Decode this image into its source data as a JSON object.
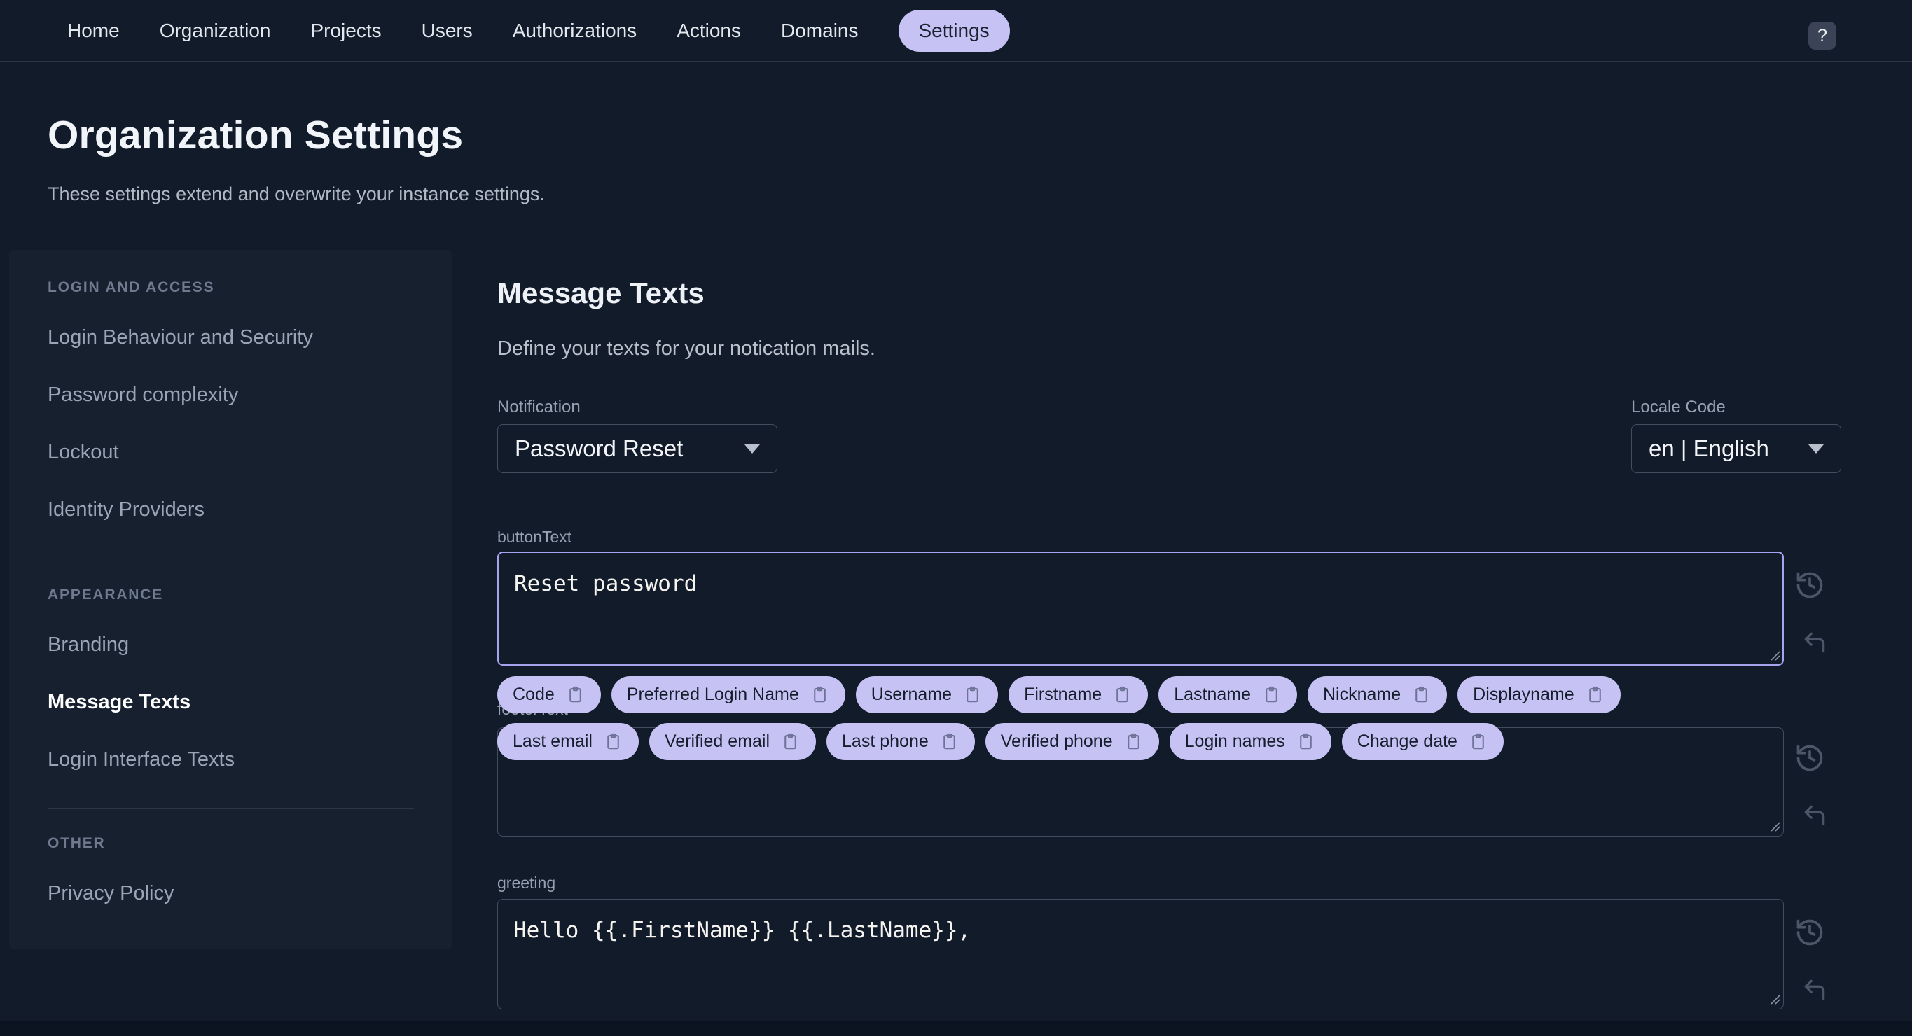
{
  "nav": {
    "items": [
      {
        "label": "Home"
      },
      {
        "label": "Organization"
      },
      {
        "label": "Projects"
      },
      {
        "label": "Users"
      },
      {
        "label": "Authorizations"
      },
      {
        "label": "Actions"
      },
      {
        "label": "Domains"
      },
      {
        "label": "Settings",
        "active": true
      }
    ],
    "help_label": "?"
  },
  "page": {
    "title": "Organization Settings",
    "subtitle": "These settings extend and overwrite your instance settings."
  },
  "sidebar": {
    "sections": [
      {
        "header": "LOGIN AND ACCESS",
        "items": [
          {
            "label": "Login Behaviour and Security"
          },
          {
            "label": "Password complexity"
          },
          {
            "label": "Lockout"
          },
          {
            "label": "Identity Providers"
          }
        ]
      },
      {
        "header": "APPEARANCE",
        "items": [
          {
            "label": "Branding"
          },
          {
            "label": "Message Texts",
            "active": true
          },
          {
            "label": "Login Interface Texts"
          }
        ]
      },
      {
        "header": "OTHER",
        "items": [
          {
            "label": "Privacy Policy"
          }
        ]
      }
    ]
  },
  "main": {
    "heading": "Message Texts",
    "description": "Define your texts for your notication mails.",
    "notification": {
      "label": "Notification",
      "value": "Password Reset"
    },
    "locale": {
      "label": "Locale Code",
      "value": "en | English"
    },
    "fields": {
      "button_text": {
        "label": "buttonText",
        "value": "Reset password"
      },
      "footer_text": {
        "label": "footerText",
        "value": ""
      },
      "greeting": {
        "label": "greeting",
        "value": "Hello {{.FirstName}} {{.LastName}},"
      }
    },
    "chips": [
      "Code",
      "Preferred Login Name",
      "Username",
      "Firstname",
      "Lastname",
      "Nickname",
      "Displayname",
      "Last email",
      "Verified email",
      "Last phone",
      "Verified phone",
      "Login names",
      "Change date"
    ]
  },
  "colors": {
    "accent": "#c6c3f4",
    "focus_border": "#a7a3ee",
    "background": "#121b2a",
    "card": "#16202f",
    "bottom_strip": "#0d1421"
  }
}
